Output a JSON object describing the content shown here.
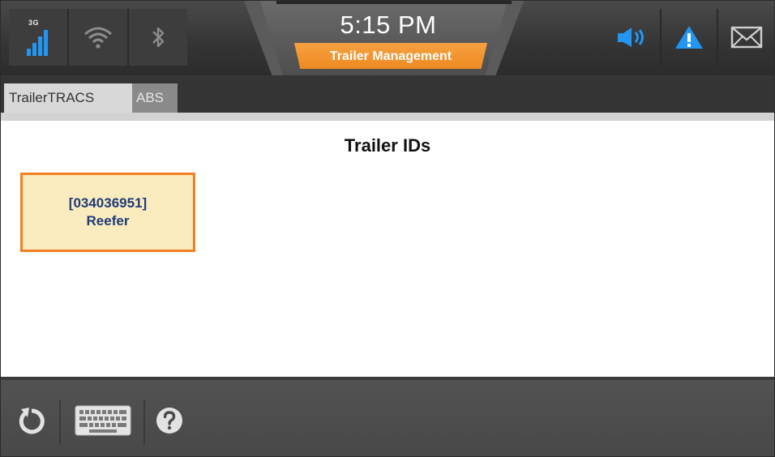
{
  "status_bar": {
    "network_type": "3G",
    "time": "5:15 PM",
    "screen_title": "Trailer Management",
    "icons": [
      "cellular-signal-icon",
      "wifi-icon",
      "bluetooth-icon",
      "volume-icon",
      "alert-icon",
      "mail-icon"
    ]
  },
  "tabs": [
    {
      "label": "TrailerTRACS",
      "active": true
    },
    {
      "label": "ABS",
      "active": false
    }
  ],
  "main": {
    "heading": "Trailer IDs",
    "trailers": [
      {
        "id": "[034036951]",
        "type": "Reefer"
      }
    ]
  },
  "bottom_bar": {
    "icons": [
      "refresh-icon",
      "keyboard-icon",
      "help-icon"
    ]
  },
  "colors": {
    "accent_orange": "#f47f20",
    "card_fill": "#fbecc0",
    "card_text": "#1f3b78",
    "signal_blue": "#2196f3"
  }
}
